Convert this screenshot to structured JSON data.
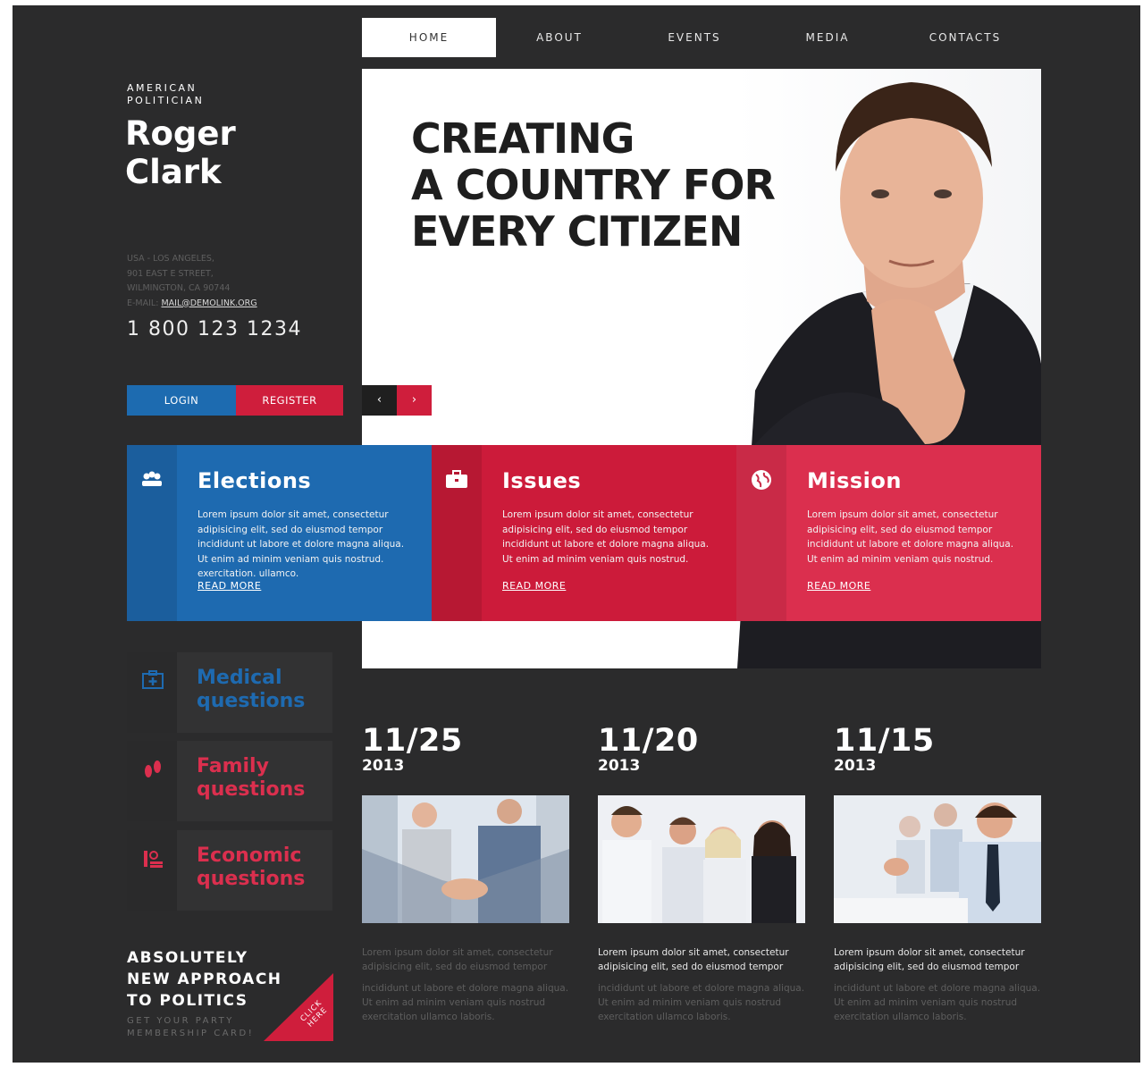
{
  "nav": {
    "items": [
      {
        "label": "HOME",
        "active": true
      },
      {
        "label": "ABOUT",
        "active": false
      },
      {
        "label": "EVENTS",
        "active": false
      },
      {
        "label": "MEDIA",
        "active": false
      },
      {
        "label": "CONTACTS",
        "active": false
      }
    ]
  },
  "profile": {
    "subtitle_line1": "AMERICAN",
    "subtitle_line2": "POLITICIAN",
    "name_line1": "Roger",
    "name_line2": "Clark",
    "address_line1": "USA - LOS ANGELES,",
    "address_line2": "901 EAST E STREET,",
    "address_line3": "WILMINGTON, CA 90744",
    "email_label": "E-MAIL:",
    "email": "MAIL@DEMOLINK.ORG",
    "phone": "1 800 123 1234"
  },
  "auth": {
    "login_label": "LOGIN",
    "register_label": "REGISTER"
  },
  "slider": {
    "prev_glyph": "‹",
    "next_glyph": "›"
  },
  "hero": {
    "title_line1": "CREATING",
    "title_line2": "A COUNTRY FOR",
    "title_line3": "EVERY CITIZEN"
  },
  "features": [
    {
      "title": "Elections",
      "icon": "people-icon",
      "text": "Lorem ipsum dolor sit amet, consectetur adipisicing elit, sed do eiusmod tempor incididunt ut labore et dolore magna aliqua. Ut enim ad minim veniam quis nostrud. exercitation. ullamco.",
      "more": "READ MORE"
    },
    {
      "title": "Issues",
      "icon": "briefcase-icon",
      "text": "Lorem ipsum dolor sit amet, consectetur adipisicing elit, sed do eiusmod tempor incididunt ut labore et dolore magna aliqua. Ut enim ad minim veniam quis nostrud.",
      "more": "READ MORE"
    },
    {
      "title": "Mission",
      "icon": "globe-icon",
      "text": "Lorem ipsum dolor sit amet, consectetur adipisicing elit, sed do eiusmod tempor incididunt ut labore et dolore magna aliqua. Ut enim ad minim veniam quis nostrud.",
      "more": "READ MORE"
    }
  ],
  "questions": [
    {
      "line1": "Medical",
      "line2": "questions",
      "icon": "medical-kit-icon",
      "color": "#1e6ab0"
    },
    {
      "line1": "Family",
      "line2": "questions",
      "icon": "footprints-icon",
      "color": "#db2f4e"
    },
    {
      "line1": "Economic",
      "line2": "questions",
      "icon": "coins-icon",
      "color": "#db2f4e"
    }
  ],
  "promo": {
    "title_line1": "ABSOLUTELY",
    "title_line2": "NEW APPROACH",
    "title_line3": "TO POLITICS",
    "sub_line1": "GET YOUR PARTY",
    "sub_line2": "MEMBERSHIP CARD!",
    "click_line1": "CLICK",
    "click_line2": "HERE"
  },
  "news": [
    {
      "date": "11/25",
      "year": "2013",
      "lead": "Lorem ipsum dolor sit amet, consectetur adipisicing elit, sed do eiusmod tempor",
      "body": "incididunt ut labore et dolore magna aliqua. Ut enim ad minim veniam quis nostrud exercitation ullamco laboris."
    },
    {
      "date": "11/20",
      "year": "2013",
      "lead": "Lorem ipsum dolor sit amet, consectetur adipisicing elit, sed do eiusmod tempor",
      "body": "incididunt ut labore et dolore magna aliqua. Ut enim ad minim veniam quis nostrud exercitation ullamco laboris."
    },
    {
      "date": "11/15",
      "year": "2013",
      "lead": "Lorem ipsum dolor sit amet, consectetur adipisicing elit, sed do eiusmod tempor",
      "body": "incididunt ut labore et dolore magna aliqua. Ut enim ad minim veniam quis nostrud exercitation ullamco laboris."
    }
  ],
  "colors": {
    "background": "#2b2b2c",
    "blue": "#1e6ab0",
    "red": "#cf1e3c",
    "pink": "#db2f4e"
  }
}
